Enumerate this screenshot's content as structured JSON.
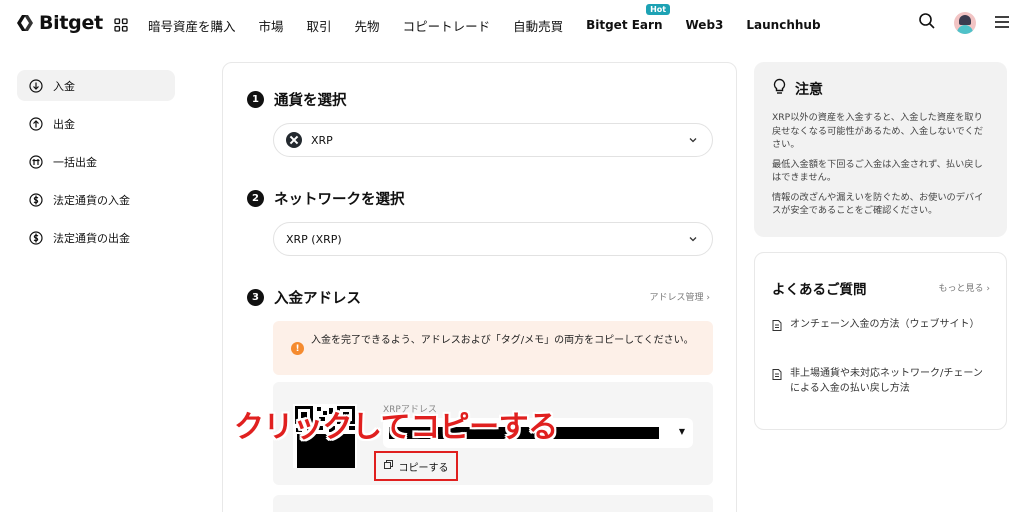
{
  "brand": {
    "name": "Bitget"
  },
  "nav": {
    "items": [
      "暗号資産を購入",
      "市場",
      "取引",
      "先物",
      "コピートレード",
      "自動売買",
      "Bitget Earn",
      "Web3",
      "Launchhub"
    ],
    "hot_badge": "Hot"
  },
  "sidebar": {
    "items": [
      {
        "label": "入金",
        "icon": "deposit-icon"
      },
      {
        "label": "出金",
        "icon": "withdraw-icon"
      },
      {
        "label": "一括出金",
        "icon": "batch-withdraw-icon"
      },
      {
        "label": "法定通貨の入金",
        "icon": "fiat-deposit-icon"
      },
      {
        "label": "法定通貨の出金",
        "icon": "fiat-withdraw-icon"
      }
    ]
  },
  "main": {
    "step1": {
      "num": "1",
      "title": "通貨を選択",
      "value": "XRP"
    },
    "step2": {
      "num": "2",
      "title": "ネットワークを選択",
      "value": "XRP (XRP)"
    },
    "step3": {
      "num": "3",
      "title": "入金アドレス",
      "manage_link": "アドレス管理 ›"
    },
    "notice": "入金を完了できるよう、アドレスおよび「タグ/メモ」の両方をコピーしてください。",
    "address_label": "XRPアドレス",
    "copy_label": "コピーする",
    "annotation": "クリックしてコピーする"
  },
  "attention": {
    "title": "注意",
    "paragraphs": [
      "XRP以外の資産を入金すると、入金した資産を取り戻せなくなる可能性があるため、入金しないでください。",
      "最低入金額を下回るご入金は入金されず、払い戻しはできません。",
      "情報の改ざんや漏えいを防ぐため、お使いのデバイスが安全であることをご確認ください。"
    ]
  },
  "faq": {
    "title": "よくあるご質問",
    "more": "もっと見る ›",
    "items": [
      "オンチェーン入金の方法（ウェブサイト）",
      "非上場通貨や未対応ネットワーク/チェーンによる入金の払い戻し方法"
    ]
  },
  "colors": {
    "annotation_red": "#e0201f",
    "notice_bg": "#fdf0e8",
    "notice_icon": "#f58b2f",
    "hot_badge": "#1da2b4"
  }
}
